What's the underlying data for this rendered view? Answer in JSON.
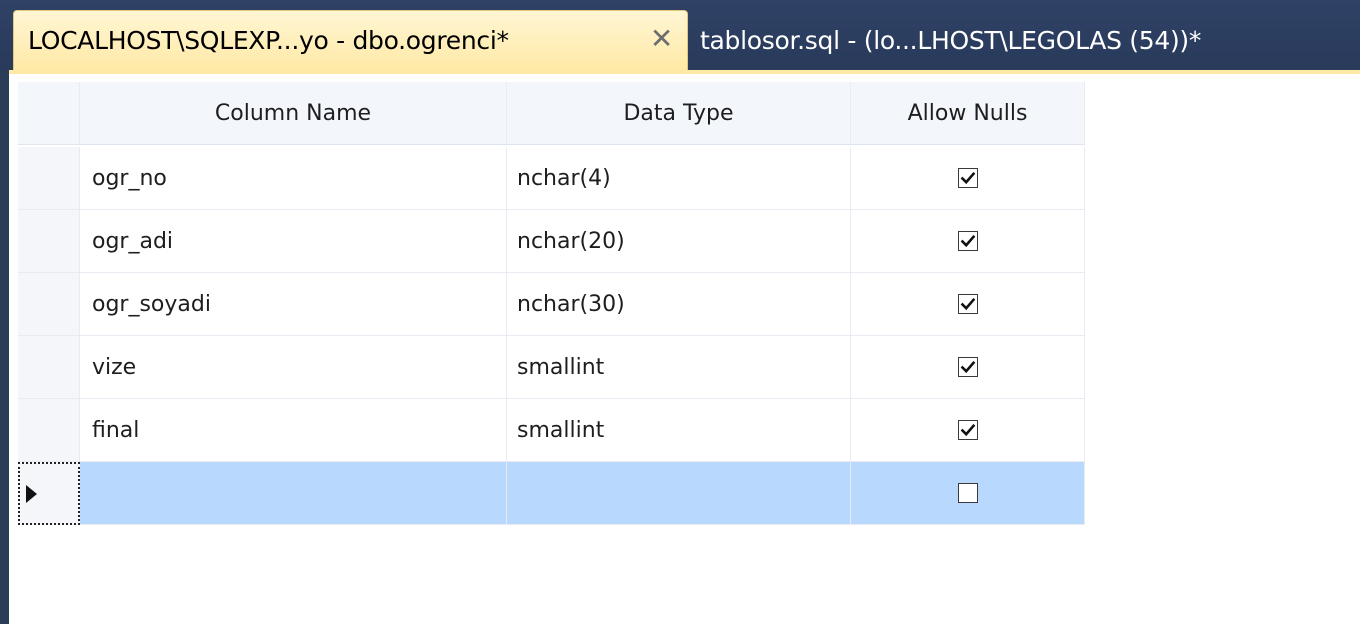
{
  "tabs": {
    "active": {
      "label": "LOCALHOST\\SQLEXP...yo - dbo.ogrenci*",
      "close_icon": "close-icon"
    },
    "inactive": {
      "label": "tablosor.sql - (lo...LHOST\\LEGOLAS (54))*"
    }
  },
  "grid": {
    "headers": {
      "column_name": "Column Name",
      "data_type": "Data Type",
      "allow_nulls": "Allow Nulls"
    },
    "rows": [
      {
        "column_name": "ogr_no",
        "data_type": "nchar(4)",
        "allow_nulls": true
      },
      {
        "column_name": "ogr_adi",
        "data_type": "nchar(20)",
        "allow_nulls": true
      },
      {
        "column_name": "ogr_soyadi",
        "data_type": "nchar(30)",
        "allow_nulls": true
      },
      {
        "column_name": "vize",
        "data_type": "smallint",
        "allow_nulls": true
      },
      {
        "column_name": "final",
        "data_type": "smallint",
        "allow_nulls": true
      },
      {
        "column_name": "",
        "data_type": "",
        "allow_nulls": false,
        "selected": true
      }
    ]
  },
  "colors": {
    "tabstrip": "#2b3c59",
    "active_tab": "#ffe9a6",
    "selected_row": "#b8d8fd"
  }
}
